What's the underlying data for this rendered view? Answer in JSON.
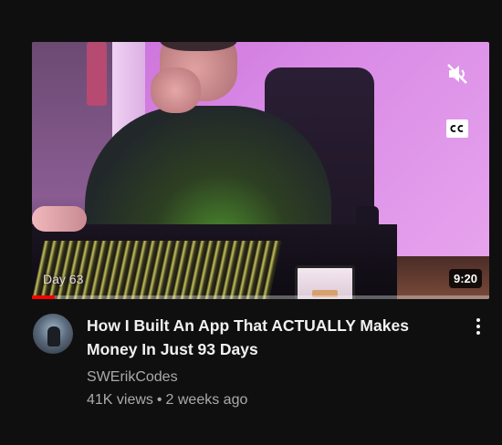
{
  "video": {
    "title_line1": "How I Built An App That ACTUALLY Makes",
    "title_line2": "Money In Just 93 Days",
    "channel": "SWErikCodes",
    "views": "41K views",
    "separator": "•",
    "age": "2 weeks ago",
    "duration": "9:20",
    "thumbnail_overlay_text": "Day 63",
    "watch_progress_fraction": 0.05
  },
  "icons": {
    "mute": "volume-muted-icon",
    "captions": "closed-captions-icon",
    "more": "more-vert-icon",
    "avatar": "channel-avatar"
  },
  "colors": {
    "background": "#0f0f0f",
    "title": "#f1f1f1",
    "secondary_text": "#aaaaaa",
    "progress": "#ff0000"
  }
}
